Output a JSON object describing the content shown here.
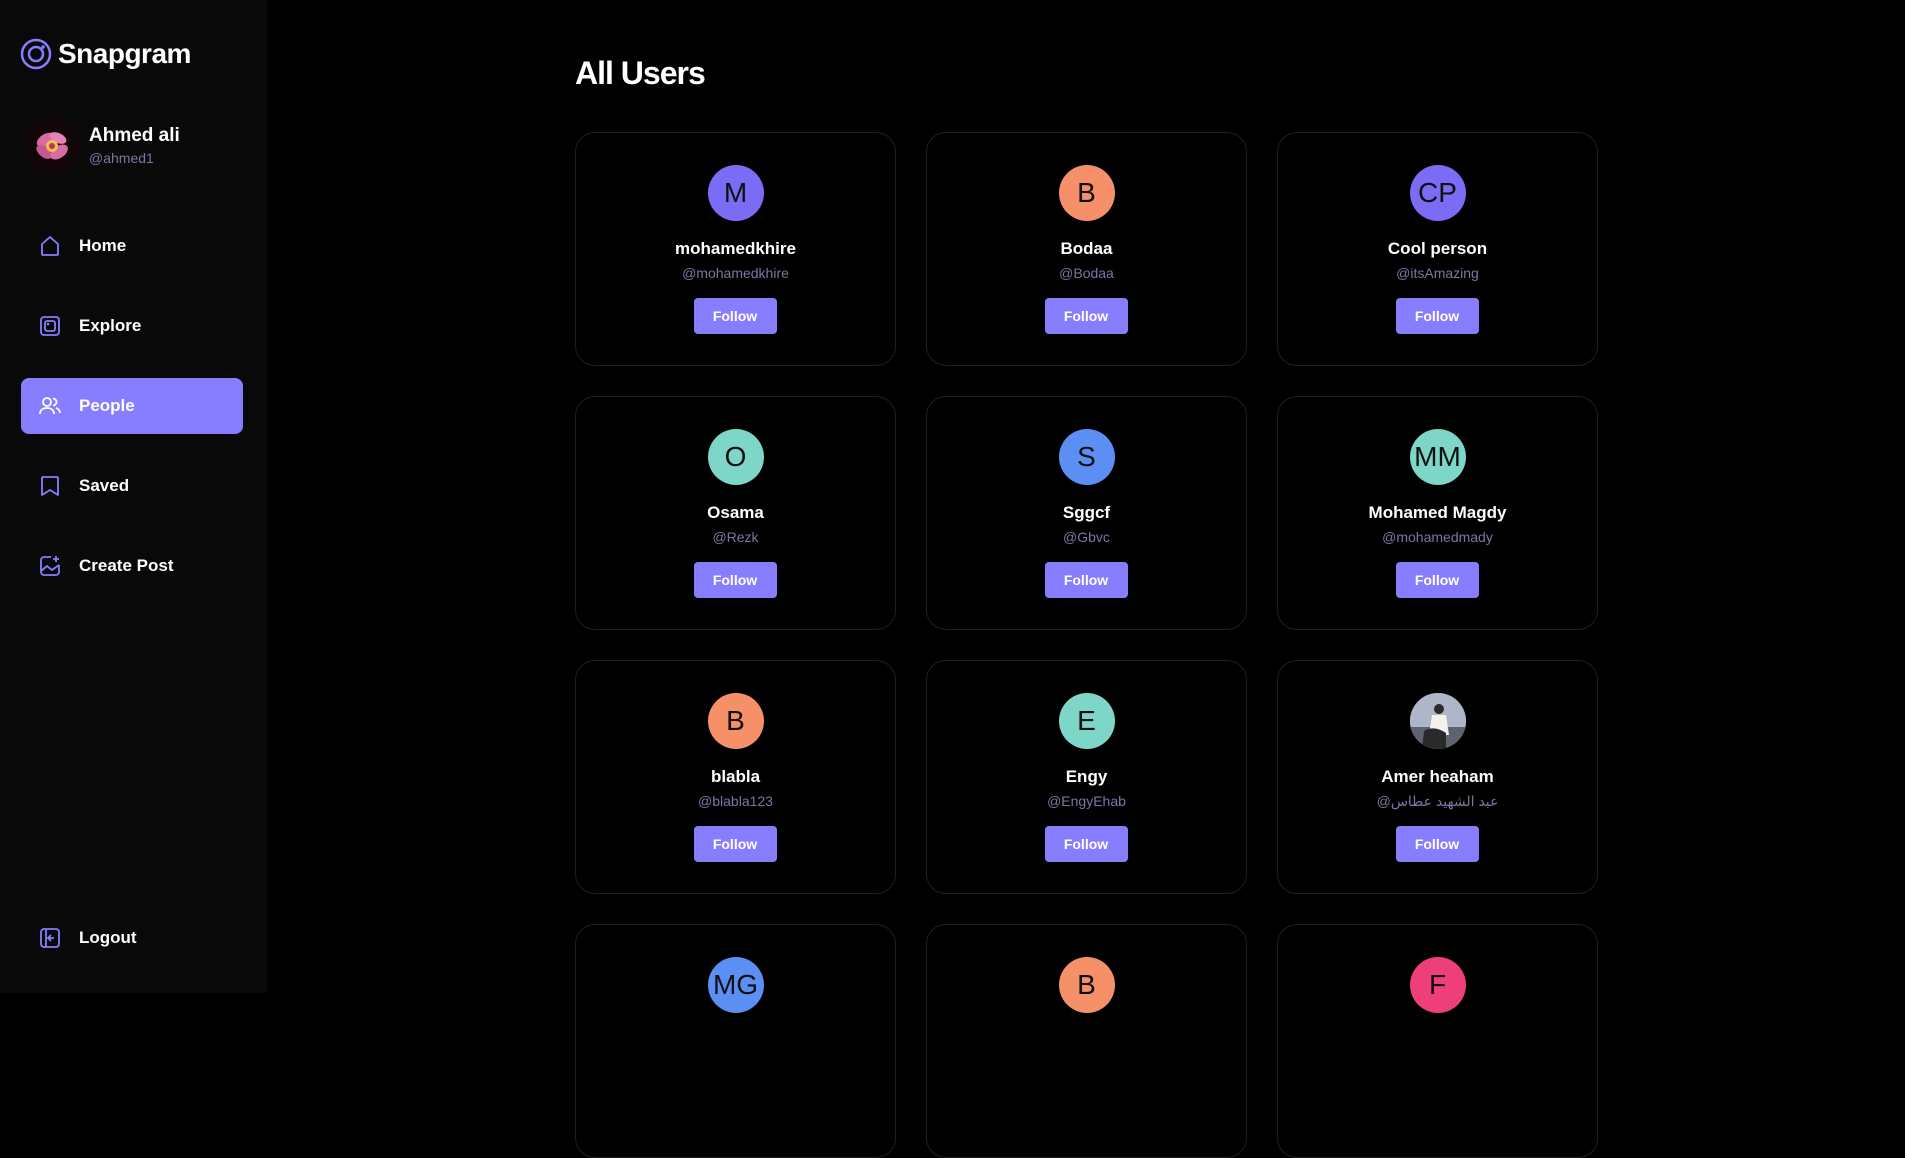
{
  "app": {
    "name": "Snapgram"
  },
  "profile": {
    "name": "Ahmed ali",
    "handle": "@ahmed1"
  },
  "nav": {
    "home": "Home",
    "explore": "Explore",
    "people": "People",
    "saved": "Saved",
    "create_post": "Create Post",
    "logout": "Logout"
  },
  "main": {
    "title": "All Users",
    "follow_label": "Follow"
  },
  "users": [
    {
      "initials": "M",
      "name": "mohamedkhire",
      "handle": "@mohamedkhire",
      "color": "#7b6cf6"
    },
    {
      "initials": "B",
      "name": "Bodaa",
      "handle": "@Bodaa",
      "color": "#f59069"
    },
    {
      "initials": "CP",
      "name": "Cool person",
      "handle": "@itsAmazing",
      "color": "#7b6cf6"
    },
    {
      "initials": "O",
      "name": "Osama",
      "handle": "@Rezk",
      "color": "#7dd6c8"
    },
    {
      "initials": "S",
      "name": "Sggcf",
      "handle": "@Gbvc",
      "color": "#5b8ff3"
    },
    {
      "initials": "MM",
      "name": "Mohamed Magdy",
      "handle": "@mohamedmady",
      "color": "#7dd6c8"
    },
    {
      "initials": "B",
      "name": "blabla",
      "handle": "@blabla123",
      "color": "#f59069"
    },
    {
      "initials": "E",
      "name": "Engy",
      "handle": "@EngyEhab",
      "color": "#7dd6c8"
    },
    {
      "initials": "",
      "name": "Amer heaham",
      "handle": "@عبد الشهيد عطاس",
      "color": "#8a93a8"
    },
    {
      "initials": "MG",
      "name": "",
      "handle": "",
      "color": "#5b8ff3"
    },
    {
      "initials": "B",
      "name": "",
      "handle": "",
      "color": "#f59069"
    },
    {
      "initials": "F",
      "name": "",
      "handle": "",
      "color": "#ef3f7a"
    }
  ],
  "colors": {
    "accent": "#877eff",
    "sidebar": "#09090a",
    "muted_text": "#7878a3"
  }
}
